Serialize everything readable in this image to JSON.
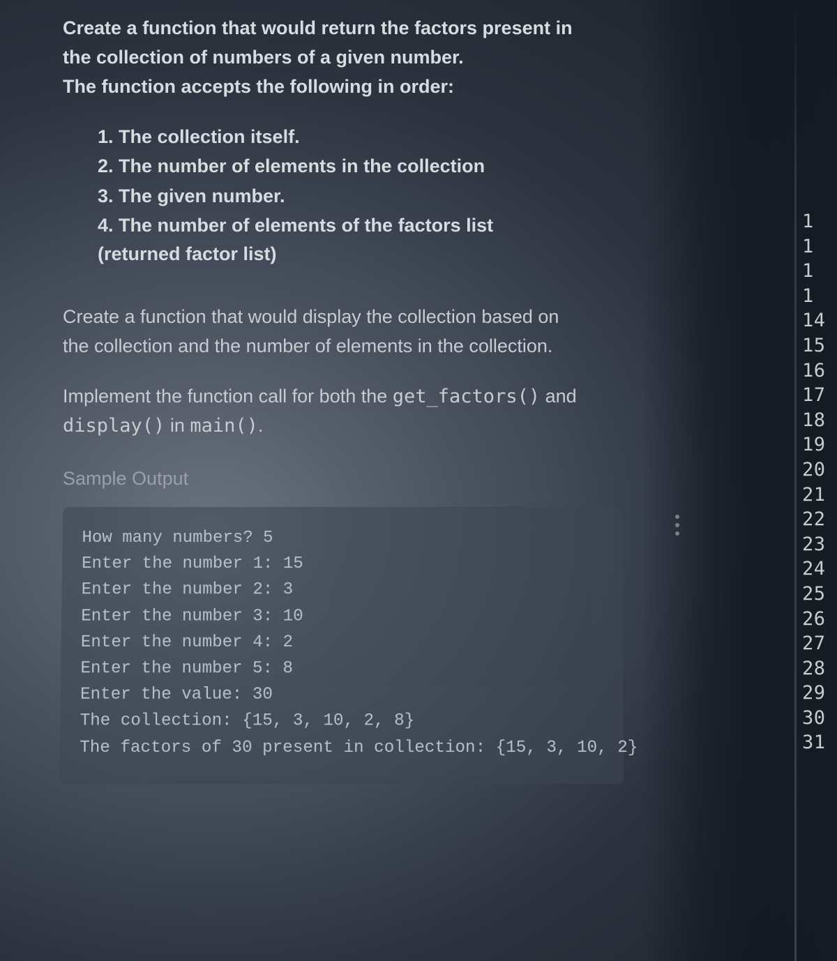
{
  "intro": {
    "p1": "Create a function that would return the factors present in the collection of numbers of a given number.",
    "p2": "The function accepts the following in order:"
  },
  "params": [
    "1. The collection itself.",
    "2. The number of elements in the collection",
    "3. The given number.",
    "4. The number of elements of the factors list (returned factor list)"
  ],
  "section2": "Create a function that would display the collection based on the collection and the number of elements in the collection.",
  "section3_a": "Implement the function call for both the ",
  "section3_b": "get_factors()",
  "section3_c": " and ",
  "section3_d": "display()",
  "section3_e": " in ",
  "section3_f": "main()",
  "section3_g": ".",
  "sample_heading": "Sample Output",
  "code": [
    "How many numbers? 5",
    "Enter the number 1: 15",
    "Enter the number 2: 3",
    "Enter the number 3: 10",
    "Enter the number 4: 2",
    "Enter the number 5: 8",
    "Enter the value: 30",
    "The collection: {15, 3, 10, 2, 8}",
    "The factors of 30 present in collection: {15, 3, 10, 2}"
  ],
  "gutter": [
    "1",
    "1",
    "1",
    "1",
    "14",
    "15",
    "16",
    "17",
    "18",
    "19",
    "20",
    "21",
    "22",
    "23",
    "24",
    "25",
    "26",
    "27",
    "28",
    "29",
    "30",
    "31"
  ]
}
